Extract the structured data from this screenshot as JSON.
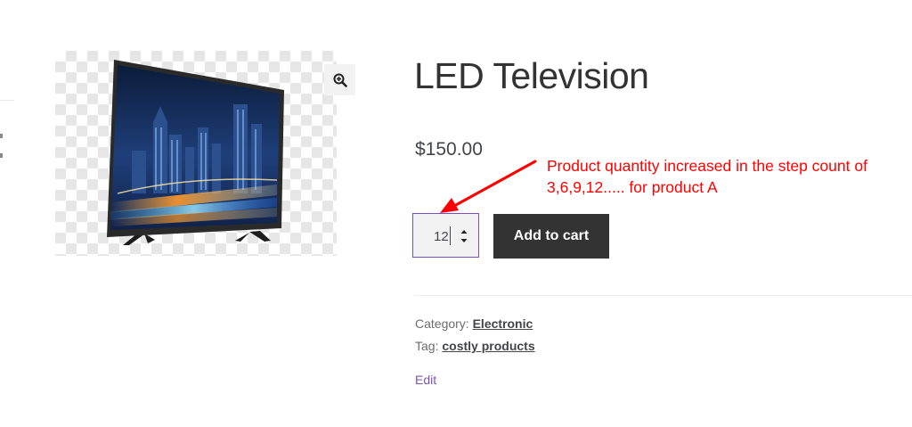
{
  "product": {
    "title": "LED Television",
    "price": "$150.00",
    "quantity": "12",
    "add_to_cart_label": "Add to cart",
    "category_label": "Category:",
    "category_value": "Electronic",
    "tag_label": "Tag:",
    "tag_value": "costly products",
    "edit_label": "Edit"
  },
  "annotation": {
    "line1": "Product quantity increased in the step count of",
    "line2": "3,6,9,12..... for product A",
    "color": "#ff0000"
  },
  "icons": {
    "zoom": "zoom-in-icon",
    "spinner": "spinner-arrows-icon"
  },
  "colors": {
    "button_bg": "#333333",
    "focus_border": "#7b4ec0",
    "edit_link": "#7f54b3"
  }
}
